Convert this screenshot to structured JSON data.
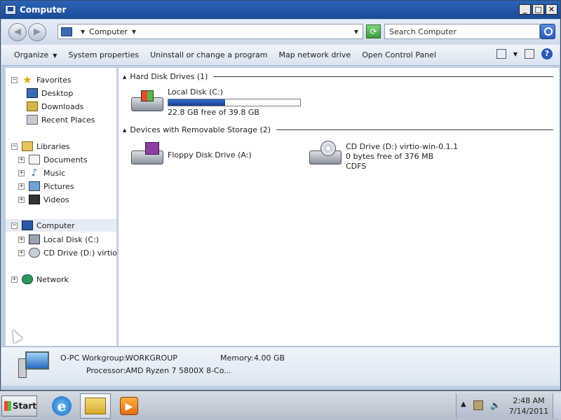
{
  "window": {
    "title": "Computer",
    "min": "_",
    "max": "□",
    "close": "✕"
  },
  "address": {
    "location": "Computer",
    "search_placeholder": "Search Computer"
  },
  "toolbar": {
    "organize": "Organize",
    "system_properties": "System properties",
    "uninstall": "Uninstall or change a program",
    "map_drive": "Map network drive",
    "control_panel": "Open Control Panel"
  },
  "sidebar": {
    "favorites": "Favorites",
    "desktop": "Desktop",
    "downloads": "Downloads",
    "recent": "Recent Places",
    "libraries": "Libraries",
    "documents": "Documents",
    "music": "Music",
    "pictures": "Pictures",
    "videos": "Videos",
    "computer": "Computer",
    "local_disk": "Local Disk (C:)",
    "cd_drive": "CD Drive (D:) virtio-win",
    "network": "Network"
  },
  "main": {
    "hdd_group": "Hard Disk Drives (1)",
    "removable_group": "Devices with Removable Storage (2)",
    "local_disk": {
      "name": "Local Disk (C:)",
      "free": "22.8 GB free of 39.8 GB",
      "used_fraction": 0.43
    },
    "floppy": {
      "name": "Floppy Disk Drive (A:)"
    },
    "cd": {
      "name": "CD Drive (D:) virtio-win-0.1.1",
      "free": "0 bytes free of 376 MB",
      "fs": "CDFS"
    }
  },
  "details": {
    "pc_name": "O-PC Workgroup:",
    "workgroup": "WORKGROUP",
    "memory_label": "Memory:",
    "memory": "4.00 GB",
    "processor_label": "Processor:",
    "processor": "AMD Ryzen 7 5800X 8-Co..."
  },
  "taskbar": {
    "start": "Start",
    "time": "2:48 AM",
    "date": "7/14/2011"
  }
}
